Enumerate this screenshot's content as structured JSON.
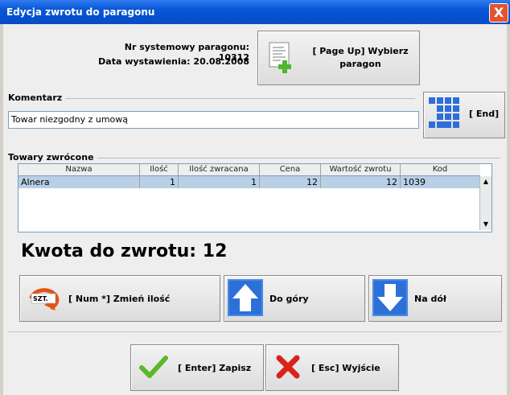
{
  "window": {
    "title": "Edycja zwrotu do paragonu",
    "close_glyph": "X"
  },
  "receipt": {
    "system_number_label": "Nr systemowy paragonu: 10312",
    "issue_date_label": "Data wystawienia: 20.08.2008",
    "select_button_line1": "[ Page Up] Wybierz",
    "select_button_line2": "paragon"
  },
  "comment": {
    "legend": "Komentarz",
    "value": "Towar niezgodny z umową",
    "keyboard_button_label": "[ End]"
  },
  "returned": {
    "legend": "Towary zwrócone",
    "columns": [
      "Nazwa",
      "Ilość",
      "Ilość zwracana",
      "Cena",
      "Wartość zwrotu",
      "Kod"
    ],
    "rows": [
      {
        "name": "Alnera",
        "qty": "1",
        "return_qty": "1",
        "price": "12",
        "return_value": "12",
        "code": "1039"
      }
    ]
  },
  "amount_label": "Kwota do zwrotu: 12",
  "actions": {
    "change_qty_icon_text": "SZT.",
    "change_qty": "[ Num *] Zmień ilość",
    "up": "Do góry",
    "down": "Na dół",
    "save": "[ Enter] Zapisz",
    "exit": "[ Esc] Wyjście"
  },
  "colors": {
    "title_bar": "#0450d0",
    "selected_row": "#b8cfe5",
    "arrow_blue": "#2c70d8",
    "check_green": "#5cb82a",
    "cross_red": "#d8231a"
  },
  "icons": [
    "receipt-add-icon",
    "numeric-keypad-icon",
    "szt-arrow-icon",
    "arrow-up-icon",
    "arrow-down-icon",
    "checkmark-icon",
    "cross-icon"
  ]
}
